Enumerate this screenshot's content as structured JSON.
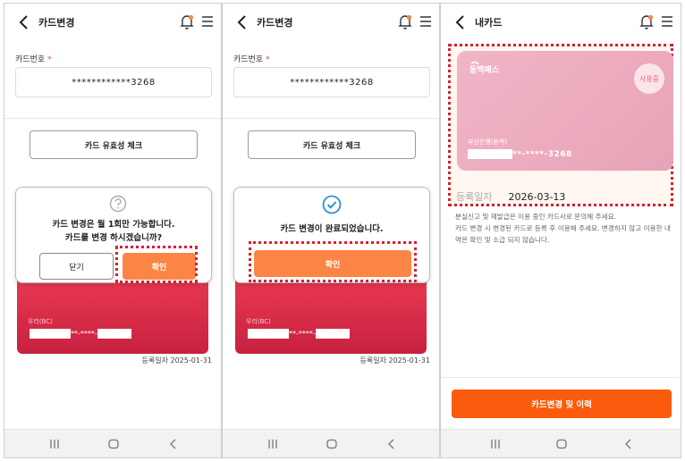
{
  "screen1": {
    "title": "카드변경",
    "card_number_label": "카드번호",
    "required_mark": "*",
    "card_number_value": "************3268",
    "validity_check_button": "카드 유효성 체크",
    "dialog": {
      "message_line1": "카드 변경은 월 1회만 가능합니다.",
      "message_line2": "카드를 변경 하시겠습니까?",
      "close_button": "닫기",
      "confirm_button": "확인"
    },
    "card_bank": "우리(BC)",
    "card_number_masked": "**-****-",
    "registration_date": "등록일자 2025-01-31"
  },
  "screen2": {
    "title": "카드변경",
    "card_number_label": "카드번호",
    "required_mark": "*",
    "card_number_value": "************3268",
    "validity_check_button": "카드 유효성 체크",
    "dialog": {
      "message": "카드 변경이 완료되었습니다.",
      "confirm_button": "확인"
    },
    "card_bank": "우리(BC)",
    "card_number_masked": "**-****-",
    "registration_date": "등록일자 2025-01-31"
  },
  "screen3": {
    "title": "내카드",
    "card_logo_text": "동백패스",
    "in_use_badge": "사용중",
    "card_bank": "부산은행(동백)",
    "card_number_masked": "**-****-3268",
    "registration_label": "등록일자",
    "registration_date": "2026-03-13",
    "notice_line1": "분실신고 및 재발급은 이용 중인 카드사로 문의해 주세요.",
    "notice_line2": "카드 변경 시 변경된 카드로 등록 후 이용해 주세요. 변경하지 않고 이용한 내역은 확인 및 소급 되지 않습니다.",
    "history_button": "카드변경 및 이력"
  },
  "colors": {
    "accent_orange": "#fb8545",
    "primary_orange": "#fb5b0c",
    "card_red": "#e4334f",
    "card_pink": "#eeadc0",
    "highlight_red": "#d8202e",
    "check_blue": "#2c8fd6"
  },
  "icons": [
    "back-arrow-icon",
    "bell-icon",
    "menu-icon",
    "question-icon",
    "check-circle-icon",
    "recent-apps-icon",
    "home-icon",
    "nav-back-icon"
  ]
}
